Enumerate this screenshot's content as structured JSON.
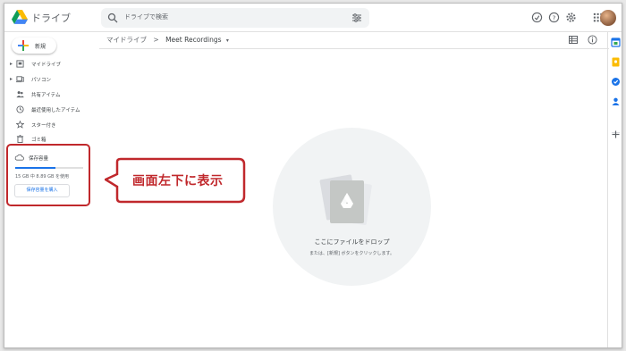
{
  "app": {
    "name": "ドライブ"
  },
  "search": {
    "placeholder": "ドライブで検索"
  },
  "new_button": {
    "label": "新規"
  },
  "sidebar": {
    "items": [
      {
        "label": "マイドライブ",
        "icon": "my-drive-icon",
        "expandable": true
      },
      {
        "label": "パソコン",
        "icon": "computer-icon",
        "expandable": true
      },
      {
        "label": "共有アイテム",
        "icon": "shared-icon",
        "expandable": false
      },
      {
        "label": "最近使用したアイテム",
        "icon": "clock-icon",
        "expandable": false
      },
      {
        "label": "スター付き",
        "icon": "star-icon",
        "expandable": false
      },
      {
        "label": "ゴミ箱",
        "icon": "trash-icon",
        "expandable": false
      }
    ]
  },
  "storage": {
    "label": "保存容量",
    "usage_text": "15 GB 中 8.89 GB を使用",
    "used_fraction": 0.59,
    "buy_label": "保存容量を購入"
  },
  "annotation": {
    "text": "画面左下に表示",
    "color": "#c0282c"
  },
  "breadcrumb": {
    "root": "マイドライブ",
    "separator": ">",
    "current": "Meet Recordings"
  },
  "empty_state": {
    "title": "ここにファイルをドロップ",
    "subtitle": "または、[新規] ボタンをクリックします。"
  },
  "colors": {
    "accent": "#1a73e8",
    "annotation": "#c0282c"
  }
}
